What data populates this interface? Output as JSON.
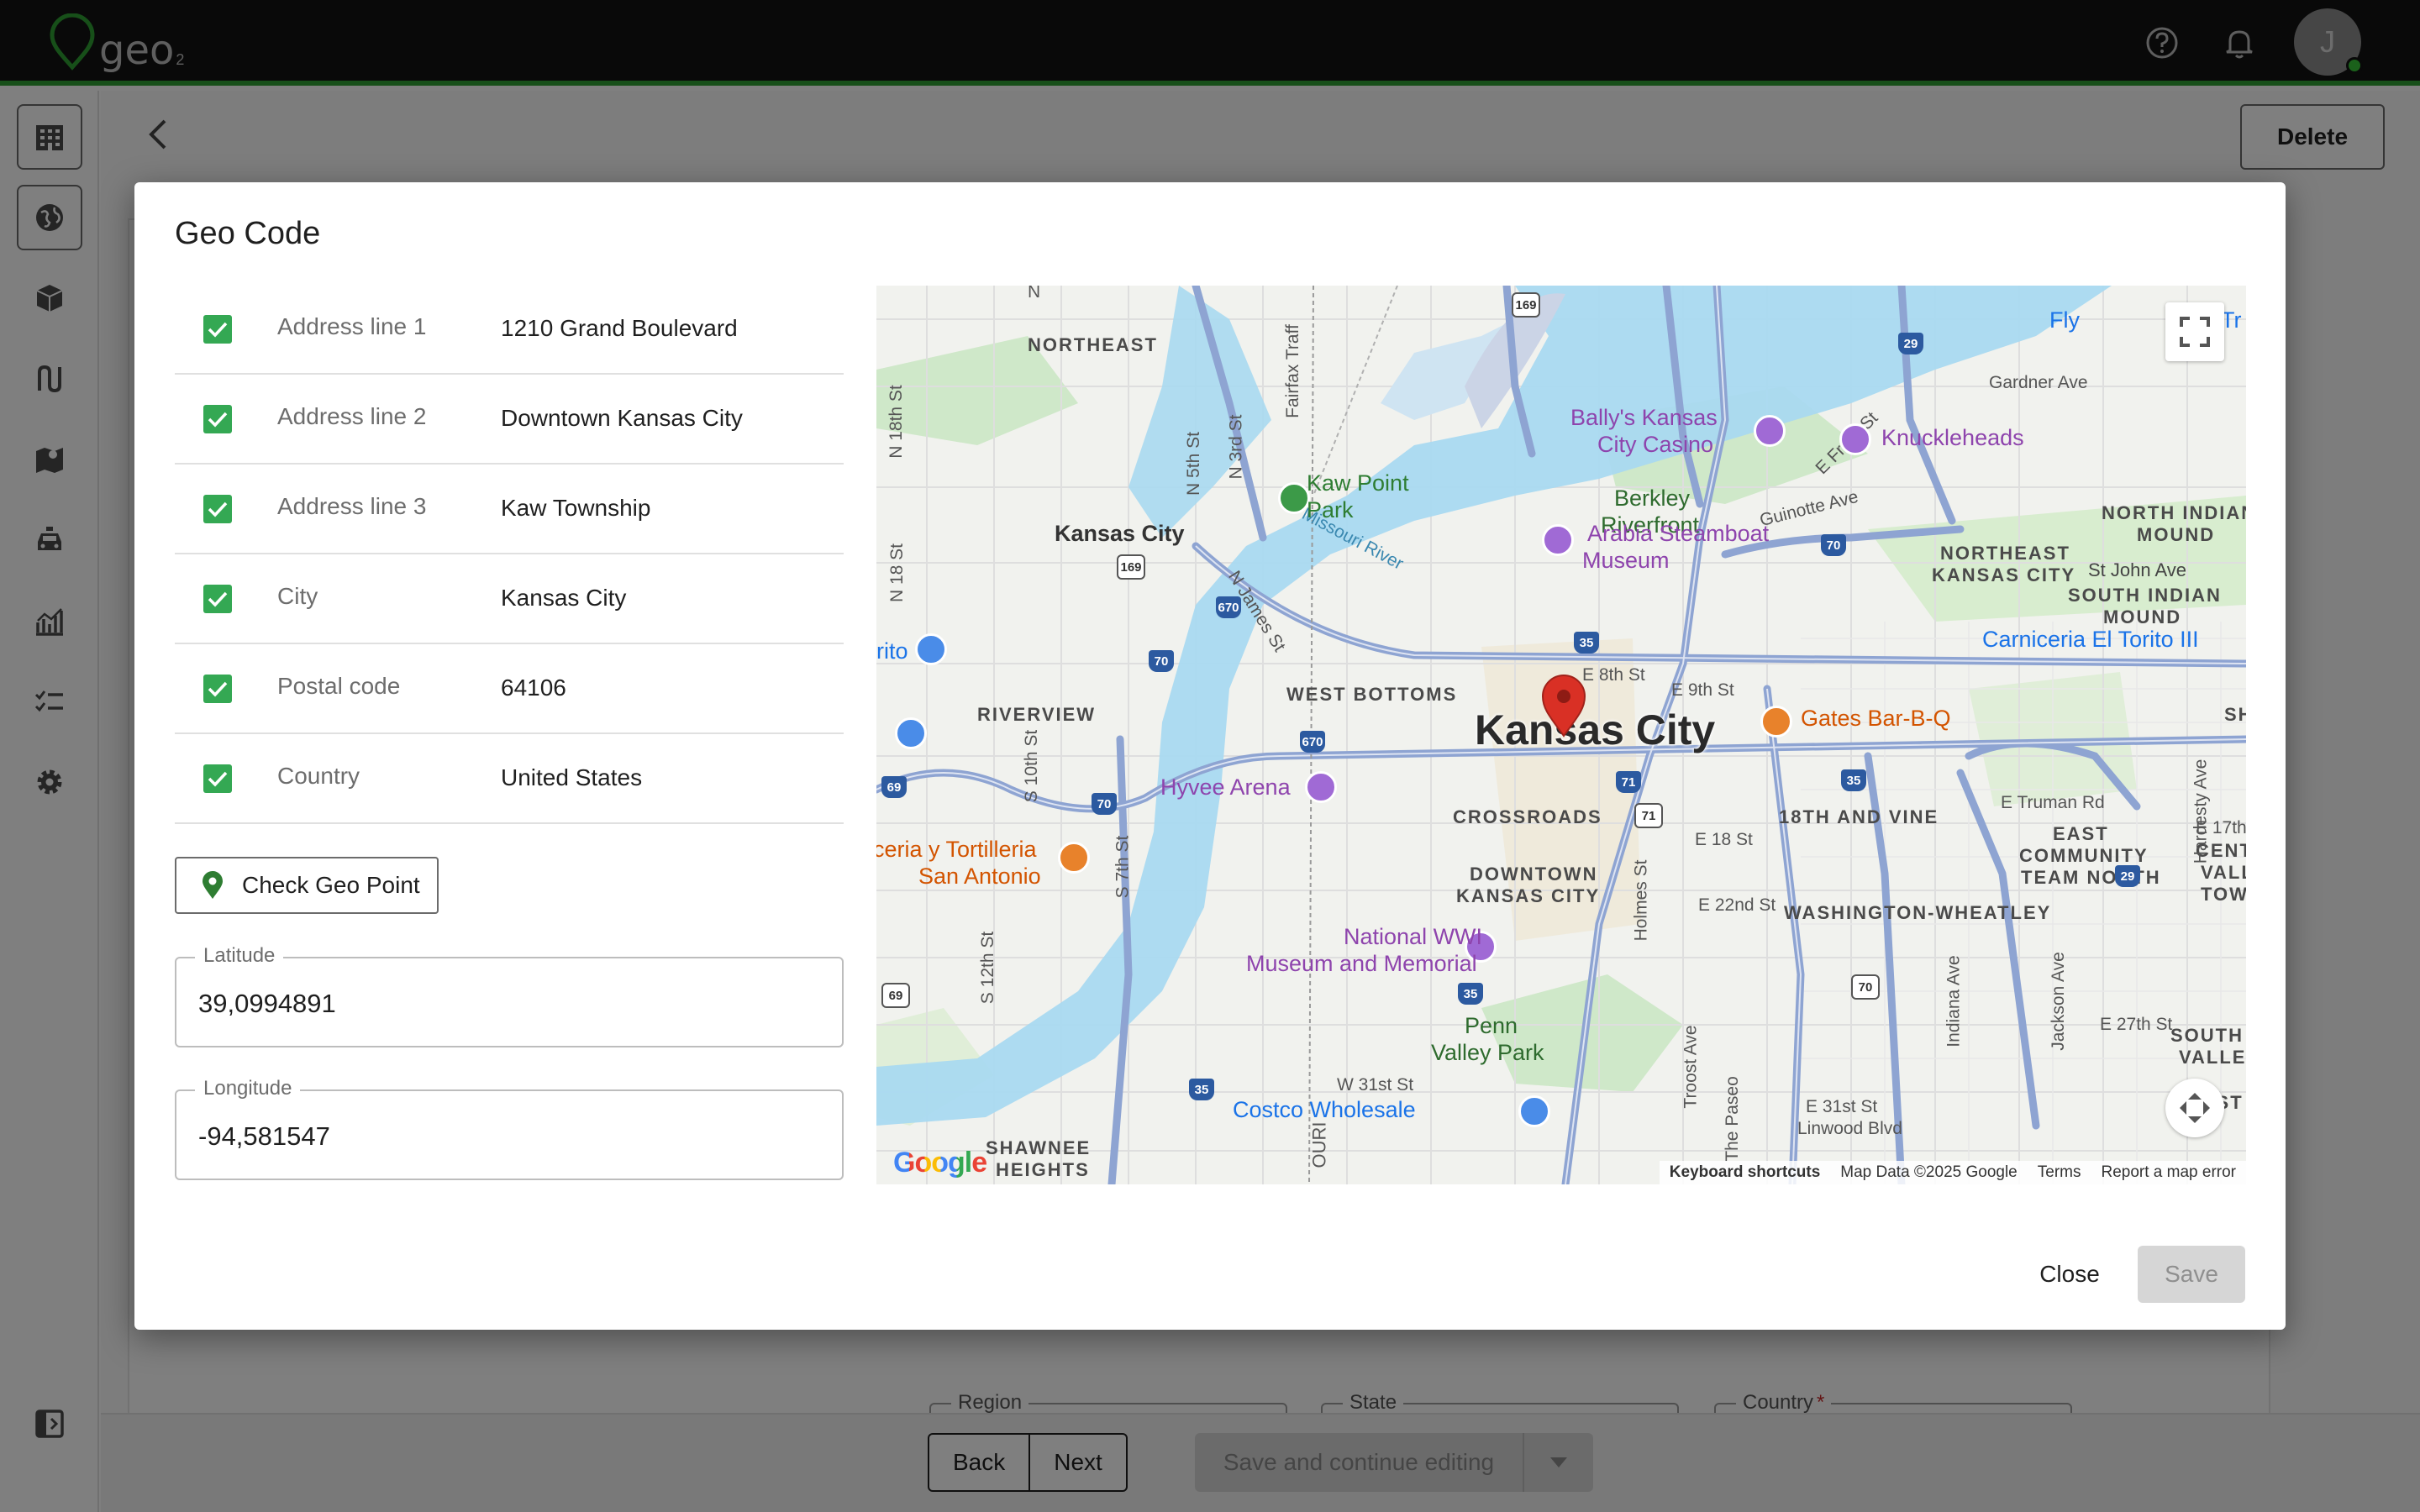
{
  "app": {
    "logo_text": "geo",
    "logo_sub": "2",
    "avatar_initial": "J"
  },
  "header": {
    "help_icon": "help-circle-icon",
    "bell_icon": "bell-icon"
  },
  "sidebar": {
    "items": [
      {
        "icon": "building-icon"
      },
      {
        "icon": "globe-icon"
      },
      {
        "icon": "package-icon"
      },
      {
        "icon": "route-icon"
      },
      {
        "icon": "map-icon"
      },
      {
        "icon": "car-icon"
      },
      {
        "icon": "chart-icon"
      },
      {
        "icon": "checklist-icon"
      },
      {
        "icon": "gear-icon"
      },
      {
        "icon": "collapse-icon"
      }
    ]
  },
  "page": {
    "delete_label": "Delete",
    "region_label": "Region",
    "state_label": "State",
    "country_label": "Country",
    "required_mark": "*",
    "back_label": "Back",
    "next_label": "Next",
    "save_continue_label": "Save and continue editing"
  },
  "dialog": {
    "title": "Geo Code",
    "rows": [
      {
        "label": "Address line 1",
        "value": "1210 Grand Boulevard",
        "checked": true
      },
      {
        "label": "Address line 2",
        "value": "Downtown Kansas City",
        "checked": true
      },
      {
        "label": "Address line 3",
        "value": "Kaw Township",
        "checked": true
      },
      {
        "label": "City",
        "value": "Kansas City",
        "checked": true
      },
      {
        "label": "Postal code",
        "value": "64106",
        "checked": true
      },
      {
        "label": "Country",
        "value": "United States",
        "checked": true
      }
    ],
    "check_button": "Check Geo Point",
    "latitude_label": "Latitude",
    "latitude_value": "39,0994891",
    "longitude_label": "Longitude",
    "longitude_value": "-94,581547",
    "close_label": "Close",
    "save_label": "Save"
  },
  "map": {
    "city_label": "Kansas City",
    "areas": {
      "northeast": "NORTHEAST",
      "riverview": "RIVERVIEW",
      "west_bottoms": "WEST BOTTOMS",
      "crossroads": "CROSSROADS",
      "downtown_kc_1": "DOWNTOWN",
      "downtown_kc_2": "KANSAS CITY",
      "vine_18th": "18TH AND VINE",
      "washington_wheatley": "WASHINGTON-WHEATLEY",
      "shawnee_1": "SHAWNEE",
      "shawnee_2": "HEIGHTS",
      "ne_kc_1": "NORTHEAST",
      "ne_kc_2": "KANSAS CITY",
      "north_indian_1": "NORTH INDIAN",
      "north_indian_2": "MOUND",
      "south_indian_1": "SOUTH INDIAN",
      "south_indian_2": "MOUND",
      "east_comm_1": "EAST",
      "east_comm_2": "COMMUNITY",
      "east_comm_3": "TEAM NORTH",
      "kck": "Kansas City",
      "st_john": "St John Ave",
      "berkley_1": "Berkley",
      "berkley_2": "Riverfront",
      "penn_1": "Penn",
      "penn_2": "Valley Park",
      "south_valle_1": "SOUTH I",
      "south_valle_2": "VALLE",
      "cent_1": "E 17th",
      "cent_2": "CENT",
      "cent_3": "VALL",
      "cent_4": "TOWE",
      "east_b": "EAST",
      "sh": "SH",
      "missouri_river": "Missouri River",
      "ouri": "OURI"
    },
    "streets": {
      "gardner": "Gardner Ave",
      "guinotte": "Guinotte Ave",
      "front": "E Front St",
      "e8th": "E 8th St",
      "e9th": "E 9th St",
      "truman": "E Truman Rd",
      "e18th": "E 18 St",
      "e22nd": "E 22nd St",
      "w31st": "W 31st St",
      "e31st": "E 31st St",
      "linwood": "Linwood Blvd",
      "e27th": "E 27th St",
      "njames": "N James St",
      "fairfax": "Fairfax Traff",
      "n5th": "N 5th St",
      "n3rd": "N 3rd St",
      "n18th": "N 18th St",
      "n18th_b": "N 18 St",
      "s10th": "S 10th St",
      "s7th": "S 7th St",
      "s12th": "S 12th St",
      "holmes": "Holmes St",
      "troost": "Troost Ave",
      "paseo": "The Paseo",
      "indiana": "Indiana Ave",
      "jackson": "Jackson Ave",
      "hardesty": "Hardesty Ave",
      "n_top": "N"
    },
    "pois": {
      "ballys_1": "Bally's Kansas",
      "ballys_2": "City Casino",
      "knuckleheads": "Knuckleheads",
      "kaw_1": "Kaw Point",
      "kaw_2": "Park",
      "arabia_1": "Arabia Steamboat",
      "arabia_2": "Museum",
      "gates": "Gates Bar-B-Q",
      "hyvee": "Hyvee Arena",
      "tortilleria_1": "ceria y Tortilleria",
      "tortilleria_2": "San Antonio",
      "wwi_1": "National WWI",
      "wwi_2": "Museum and Memorial",
      "costco": "Costco Wholesale",
      "carniceria": "Carniceria El Torito III",
      "fly": "Fly",
      "tr": "Tr",
      "rito": "rito"
    },
    "routes": [
      "169",
      "29",
      "29",
      "70",
      "70",
      "70",
      "670",
      "670",
      "35",
      "35",
      "35",
      "35",
      "71",
      "71",
      "70",
      "69",
      "69",
      "169"
    ],
    "google": "Google",
    "keyboard_shortcuts": "Keyboard shortcuts",
    "map_data": "Map Data ©2025 Google",
    "terms": "Terms",
    "report": "Report a map error"
  },
  "colors": {
    "accent_green": "#2e9e33",
    "checkbox": "#34a853",
    "pin": "#d93025"
  }
}
